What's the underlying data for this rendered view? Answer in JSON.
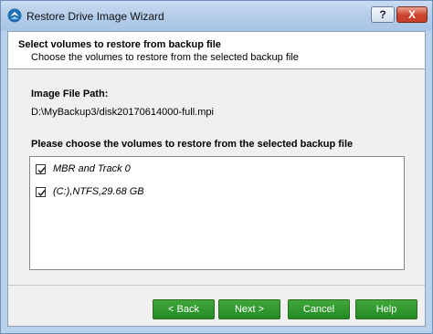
{
  "window": {
    "title": "Restore Drive Image Wizard",
    "help_label": "?",
    "close_label": "X"
  },
  "header": {
    "title": "Select volumes to restore from backup file",
    "subtitle": "Choose the volumes to restore from the selected backup file"
  },
  "image_file": {
    "label": "Image File Path:",
    "path": "D:\\MyBackup3/disk20170614000-full.mpi"
  },
  "volumes": {
    "label": "Please choose the volumes to restore from the selected backup file",
    "items": [
      {
        "label": "MBR and Track 0",
        "checked": true
      },
      {
        "label": "(C:),NTFS,29.68 GB",
        "checked": true
      }
    ]
  },
  "buttons": {
    "back": "< Back",
    "next": "Next >",
    "cancel": "Cancel",
    "help": "Help"
  },
  "colors": {
    "button_green": "#228a24",
    "title_bar": "#b4cde9"
  }
}
